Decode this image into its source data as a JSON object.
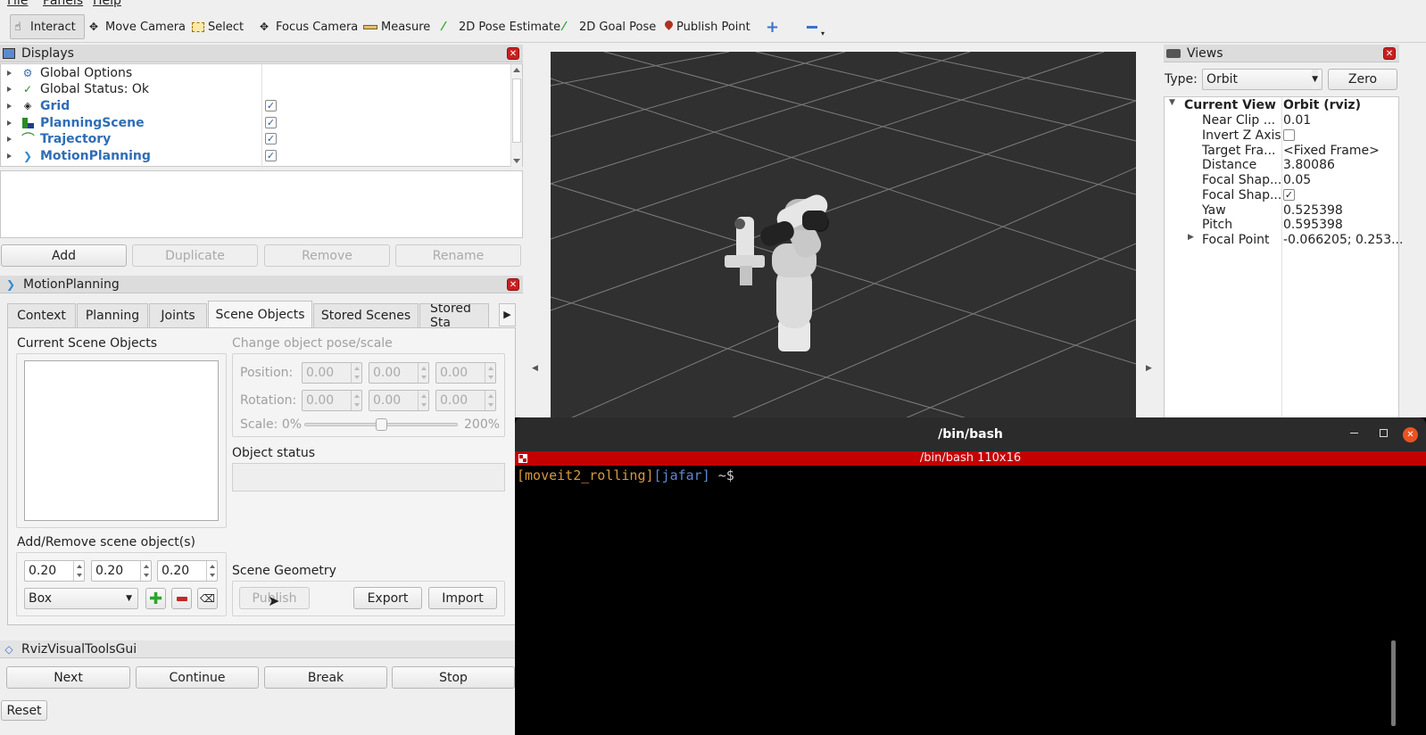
{
  "menu": {
    "file": "File",
    "panels": "Panels",
    "help": "Help"
  },
  "toolbar": {
    "interact": "Interact",
    "move_camera": "Move Camera",
    "select": "Select",
    "focus_camera": "Focus Camera",
    "measure": "Measure",
    "pose_estimate": "2D Pose Estimate",
    "goal_pose": "2D Goal Pose",
    "publish_point": "Publish Point"
  },
  "displays": {
    "title": "Displays",
    "items": [
      {
        "label": "Global Options",
        "checked": false
      },
      {
        "label": "Global Status: Ok",
        "checked": false
      },
      {
        "label": "Grid",
        "checked": true
      },
      {
        "label": "PlanningScene",
        "checked": true
      },
      {
        "label": "Trajectory",
        "checked": true
      },
      {
        "label": "MotionPlanning",
        "checked": true
      }
    ],
    "check_mark": "✓",
    "buttons": {
      "add": "Add",
      "duplicate": "Duplicate",
      "remove": "Remove",
      "rename": "Rename"
    }
  },
  "motion_planning": {
    "title": "MotionPlanning",
    "tabs": [
      "Context",
      "Planning",
      "Joints",
      "Scene Objects",
      "Stored Scenes",
      "Stored Sta"
    ],
    "active_tab": "Scene Objects",
    "current_scene_objects": "Current Scene Objects",
    "change_pose": "Change object pose/scale",
    "position_label": "Position:",
    "rotation_label": "Rotation:",
    "scale_label": "Scale: 0%",
    "scale_max": "200%",
    "scale_value": 0.5,
    "pose_value": "0.00",
    "object_status": "Object status",
    "add_remove": "Add/Remove scene object(s)",
    "size_values": [
      "0.20",
      "0.20",
      "0.20"
    ],
    "shape": "Box",
    "scene_geometry": "Scene Geometry",
    "publish": "Publish",
    "export": "Export",
    "import": "Import"
  },
  "rviz_visual_tools": {
    "title": "RvizVisualToolsGui",
    "buttons": [
      "Next",
      "Continue",
      "Break",
      "Stop"
    ],
    "reset": "Reset"
  },
  "views": {
    "title": "Views",
    "type_label": "Type:",
    "type_value": "Orbit (rviz_defau",
    "zero": "Zero",
    "current_view": "Current View",
    "current_view_value": "Orbit (rviz)",
    "props": [
      {
        "key": "Near Clip ...",
        "value": "0.01"
      },
      {
        "key": "Invert Z Axis",
        "value": ""
      },
      {
        "key": "Target Fra...",
        "value": "<Fixed Frame>"
      },
      {
        "key": "Distance",
        "value": "3.80086"
      },
      {
        "key": "Focal Shap...",
        "value": "0.05"
      },
      {
        "key": "Focal Shap...",
        "value": "✓"
      },
      {
        "key": "Yaw",
        "value": "0.525398"
      },
      {
        "key": "Pitch",
        "value": "0.595398"
      },
      {
        "key": "Focal Point",
        "value": "-0.066205; 0.253..."
      }
    ]
  },
  "terminal": {
    "title": "/bin/bash",
    "status_bar": "/bin/bash 110x16",
    "prompt_env": "[moveit2_rolling]",
    "prompt_user": "[jafar]",
    "prompt_tail": " ~$"
  },
  "colors": {
    "link_blue": "#2f6db6",
    "viewport_bg": "#303030",
    "terminal_red": "#c40000",
    "prompt_orange": "#d79a3a",
    "prompt_blue": "#5f87d7"
  }
}
